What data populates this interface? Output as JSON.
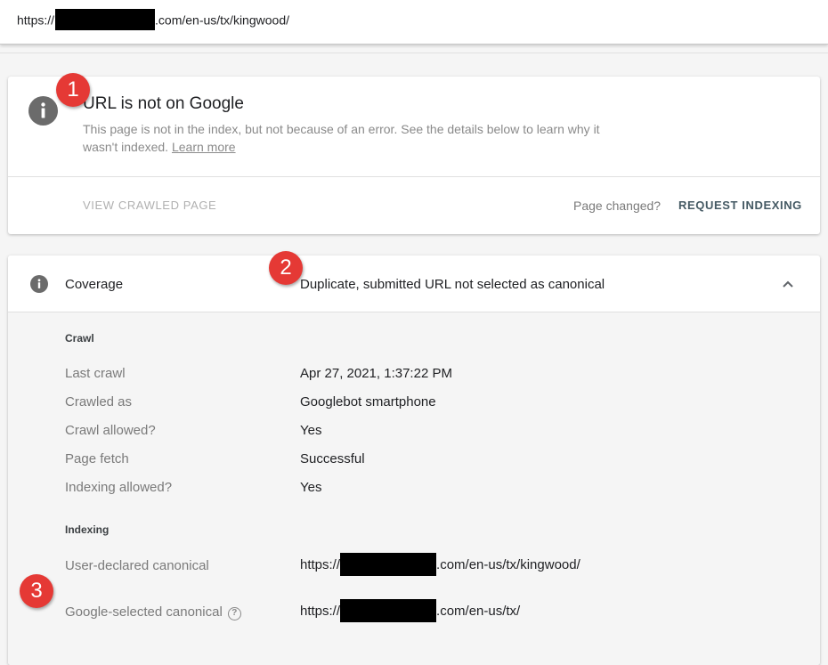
{
  "url_bar": {
    "prefix": "https://",
    "suffix": ".com/en-us/tx/kingwood/"
  },
  "status": {
    "title": "URL is not on Google",
    "description": "This page is not in the index, but not because of an error. See the details below to learn why it wasn't indexed.",
    "learn_more": "Learn more",
    "view_crawled": "VIEW CRAWLED PAGE",
    "page_changed": "Page changed?",
    "request_indexing": "REQUEST INDEXING"
  },
  "coverage": {
    "label": "Coverage",
    "value": "Duplicate, submitted URL not selected as canonical",
    "crawl_section": "Crawl",
    "crawl_rows": [
      {
        "label": "Last crawl",
        "value": "Apr 27, 2021, 1:37:22 PM"
      },
      {
        "label": "Crawled as",
        "value": "Googlebot smartphone"
      },
      {
        "label": "Crawl allowed?",
        "value": "Yes"
      },
      {
        "label": "Page fetch",
        "value": "Successful"
      },
      {
        "label": "Indexing allowed?",
        "value": "Yes"
      }
    ],
    "indexing_section": "Indexing",
    "user_canonical": {
      "label": "User-declared canonical",
      "prefix": "https://",
      "suffix": ".com/en-us/tx/kingwood/"
    },
    "google_canonical": {
      "label": "Google-selected canonical",
      "help": "?",
      "prefix": "https://",
      "suffix": ".com/en-us/tx/"
    }
  },
  "badges": [
    "1",
    "2",
    "3"
  ],
  "colors": {
    "badge": "#e53935",
    "icon_gray": "#6b6b6b",
    "action_text": "#455a64"
  },
  "icons": {
    "status": "info-icon",
    "coverage": "info-icon",
    "toggle": "chevron-up-icon",
    "help": "help-circle-icon"
  }
}
